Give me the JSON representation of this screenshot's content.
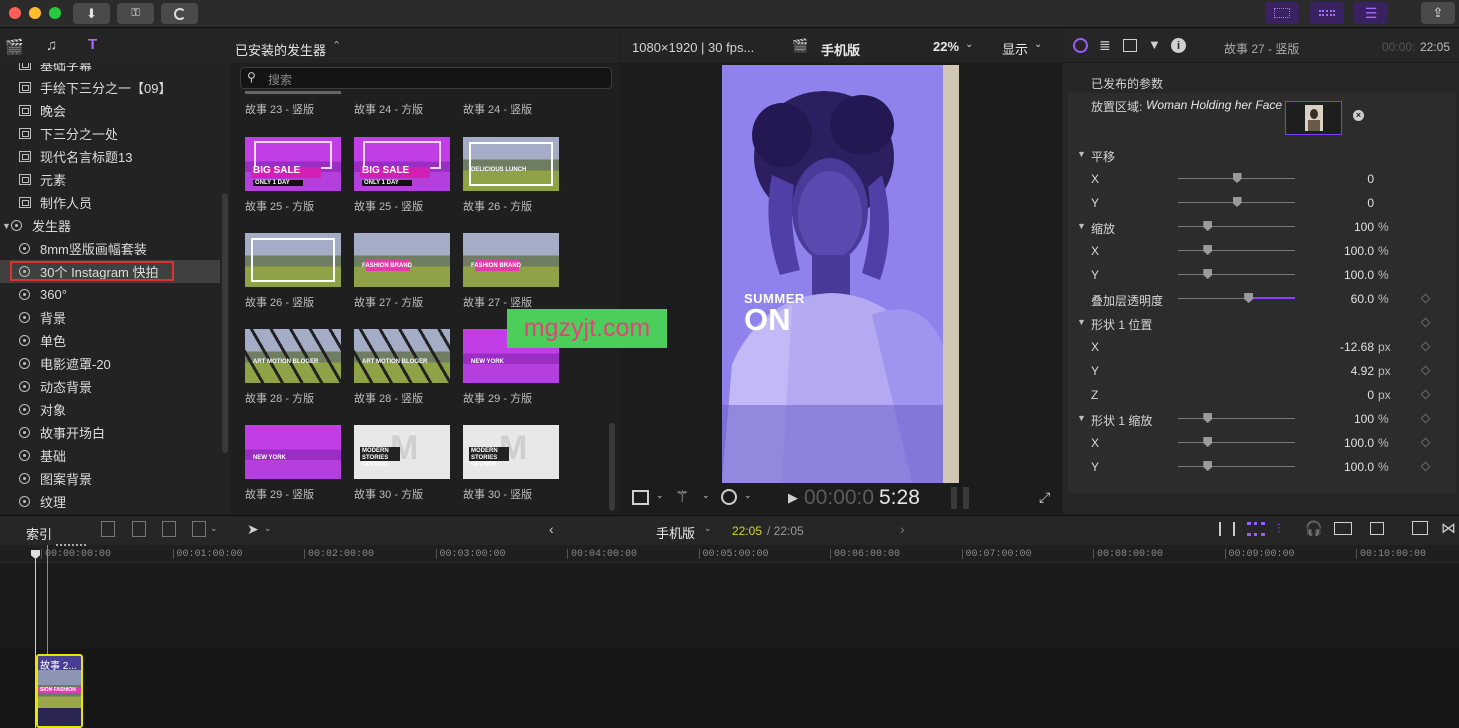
{
  "sidebar": {
    "items": [
      {
        "label": "基础字幕",
        "icon": "title-icon"
      },
      {
        "label": "手绘下三分之一【09】",
        "icon": "title-icon"
      },
      {
        "label": "晚会",
        "icon": "title-icon"
      },
      {
        "label": "下三分之一处",
        "icon": "title-icon"
      },
      {
        "label": "现代名言标题13",
        "icon": "title-icon"
      },
      {
        "label": "元素",
        "icon": "title-icon"
      },
      {
        "label": "制作人员",
        "icon": "title-icon"
      },
      {
        "label": "发生器",
        "icon": "generator-icon"
      },
      {
        "label": "8mm竖版画幅套装",
        "icon": "generator-icon"
      },
      {
        "label": "30个 Instagram 快拍",
        "icon": "generator-icon"
      },
      {
        "label": "360°",
        "icon": "generator-icon"
      },
      {
        "label": "背景",
        "icon": "generator-icon"
      },
      {
        "label": "单色",
        "icon": "generator-icon"
      },
      {
        "label": "电影遮罩-20",
        "icon": "generator-icon"
      },
      {
        "label": "动态背景",
        "icon": "generator-icon"
      },
      {
        "label": "对象",
        "icon": "generator-icon"
      },
      {
        "label": "故事开场白",
        "icon": "generator-icon"
      },
      {
        "label": "基础",
        "icon": "generator-icon"
      },
      {
        "label": "图案背景",
        "icon": "generator-icon"
      },
      {
        "label": "纹理",
        "icon": "generator-icon"
      }
    ]
  },
  "browser": {
    "header": "已安装的发生器",
    "search_placeholder": "搜索",
    "top_labels": [
      "故事 23 - 竖版",
      "故事 24 - 方版",
      "故事 24 - 竖版"
    ],
    "thumbs": [
      {
        "label": "故事 25 - 方版",
        "text": "BIG SALE",
        "sub": "ONLY 1 DAY",
        "style": "magenta"
      },
      {
        "label": "故事 25 - 竖版",
        "text": "BIG SALE",
        "sub": "ONLY 1 DAY",
        "style": "magenta"
      },
      {
        "label": "故事 26 - 方版",
        "text": "DELICIOUS LUNCH",
        "sub": "",
        "style": "frame"
      },
      {
        "label": "故事 26 - 竖版",
        "text": "",
        "sub": "",
        "style": "frame"
      },
      {
        "label": "故事 27 - 方版",
        "text": "FASHION BRAND",
        "sub": "",
        "style": "pink"
      },
      {
        "label": "故事 27 - 竖版",
        "text": "FASHION BRAND",
        "sub": "",
        "style": "pink"
      },
      {
        "label": "故事 28 - 方版",
        "text": "ART MOTION BLOGER",
        "sub": "",
        "style": "stripes"
      },
      {
        "label": "故事 28 - 竖版",
        "text": "ART MOTION BLOGER",
        "sub": "",
        "style": "stripes"
      },
      {
        "label": "故事 29 - 方版",
        "text": "NEW YORK",
        "sub": "",
        "style": "purple"
      },
      {
        "label": "故事 29 - 竖版",
        "text": "NEW YORK",
        "sub": "",
        "style": "purple"
      },
      {
        "label": "故事 30 - 方版",
        "text": "MODERN STORIES OPENER",
        "sub": "",
        "style": "white"
      },
      {
        "label": "故事 30 - 竖版",
        "text": "MODERN STORIES OPENER",
        "sub": "",
        "style": "white"
      }
    ]
  },
  "viewer": {
    "format": "1080×1920 | 30 fps...",
    "project": "手机版",
    "zoom": "22%",
    "display": "显示",
    "canvas_text_1": "SUMMER",
    "canvas_text_2": "ON",
    "timecode_dim": "00:00:0",
    "timecode_bright": "5:28",
    "watermark": "mgzyjt.com"
  },
  "inspector": {
    "title": "故事 27 - 竖版",
    "timecode_dim": "00:00:",
    "timecode": "22:05",
    "section": "已发布的参数",
    "drop_zone_label": "放置区域:",
    "drop_zone_value": "Woman Holding her Face",
    "params": [
      {
        "name": "平移",
        "group": true,
        "value": "",
        "unit": "",
        "slider": null,
        "kf": false
      },
      {
        "name": "X",
        "group": false,
        "value": "0",
        "unit": "",
        "slider": 0.5,
        "kf": false
      },
      {
        "name": "Y",
        "group": false,
        "value": "0",
        "unit": "",
        "slider": 0.5,
        "kf": false
      },
      {
        "name": "缩放",
        "group": true,
        "value": "100",
        "unit": "%",
        "slider": 0.25,
        "kf": false
      },
      {
        "name": "X",
        "group": false,
        "value": "100.0",
        "unit": "%",
        "slider": 0.25,
        "kf": false
      },
      {
        "name": "Y",
        "group": false,
        "value": "100.0",
        "unit": "%",
        "slider": 0.25,
        "kf": false
      },
      {
        "name": "叠加层透明度",
        "group": false,
        "value": "60.0",
        "unit": "%",
        "slider": 0.6,
        "kf": true
      },
      {
        "name": "形状 1 位置",
        "group": true,
        "value": "",
        "unit": "",
        "slider": null,
        "kf": true
      },
      {
        "name": "X",
        "group": false,
        "value": "-12.68",
        "unit": "px",
        "slider": null,
        "kf": true
      },
      {
        "name": "Y",
        "group": false,
        "value": "4.92",
        "unit": "px",
        "slider": null,
        "kf": true
      },
      {
        "name": "Z",
        "group": false,
        "value": "0",
        "unit": "px",
        "slider": null,
        "kf": true
      },
      {
        "name": "形状 1 缩放",
        "group": true,
        "value": "100",
        "unit": "%",
        "slider": 0.25,
        "kf": true
      },
      {
        "name": "X",
        "group": false,
        "value": "100.0",
        "unit": "%",
        "slider": 0.25,
        "kf": true
      },
      {
        "name": "Y",
        "group": false,
        "value": "100.0",
        "unit": "%",
        "slider": 0.25,
        "kf": true
      }
    ]
  },
  "timeline": {
    "index_label": "索引",
    "project": "手机版",
    "time_current": "22:05",
    "time_total": "/ 22:05",
    "ruler": [
      "00:00:00:00",
      "00:01:00:00",
      "00:02:00:00",
      "00:03:00:00",
      "00:04:00:00",
      "00:05:00:00",
      "00:06:00:00",
      "00:07:00:00",
      "00:08:00:00",
      "00:09:00:00",
      "00:10:00:00"
    ],
    "clip_title": "故事 2..."
  },
  "colors": {
    "accent": "#7a3cff",
    "playhead": "#e0733a",
    "selection_red": "#e03030",
    "clip_border": "#e6e600",
    "timecode_yellow": "#d6d630",
    "watermark_bg": "#4ccf5a",
    "watermark_text": "#e0457a"
  }
}
